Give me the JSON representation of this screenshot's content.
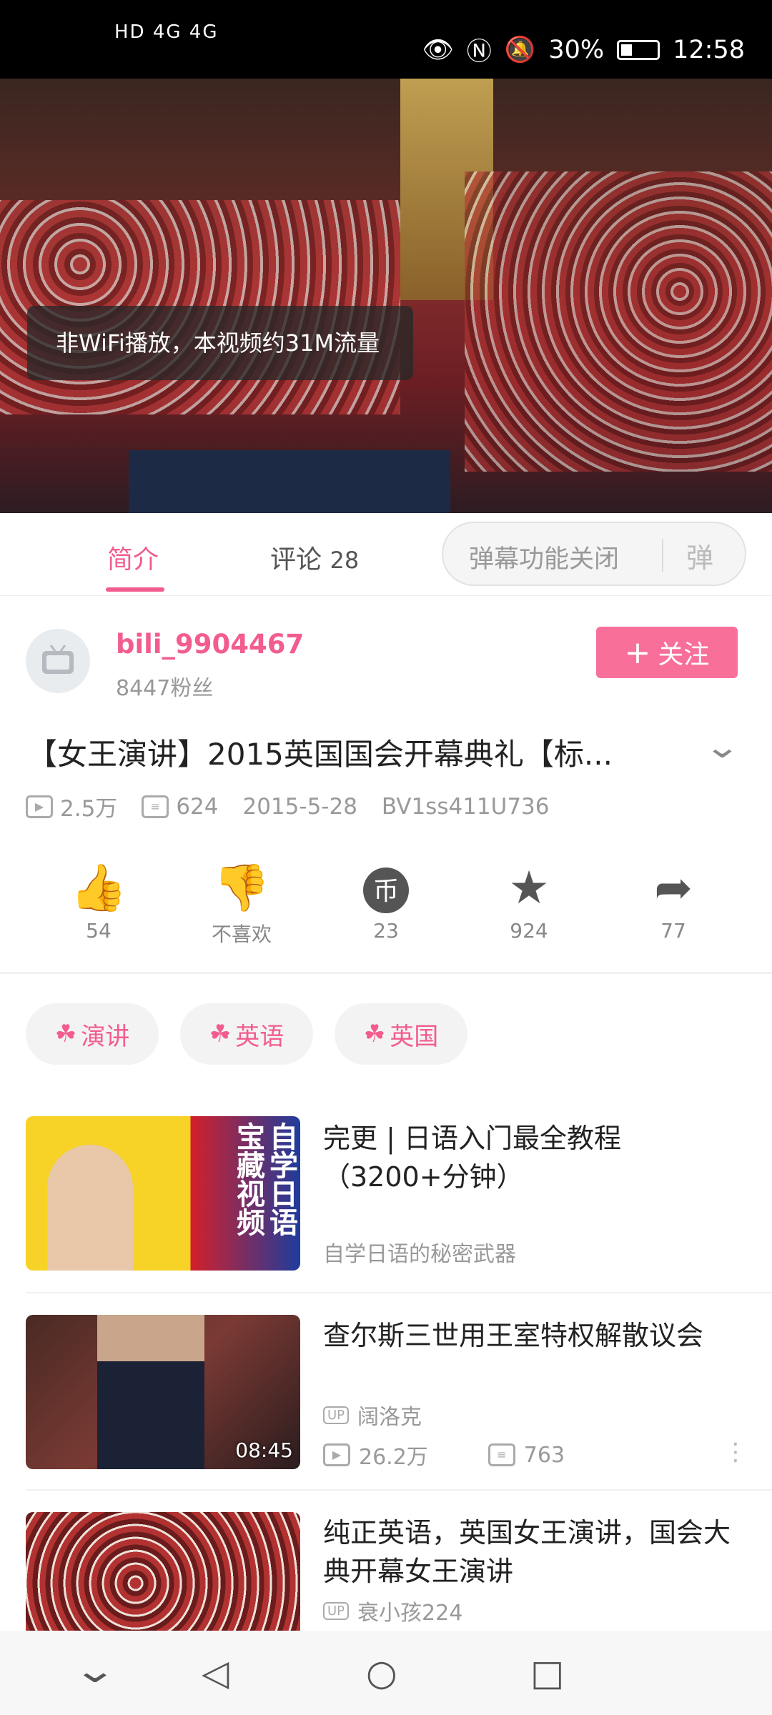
{
  "status_bar": {
    "left": "HD 4G 4G",
    "battery": "30%",
    "time": "12:58"
  },
  "video": {
    "toast": "非WiFi播放，本视频约31M流量"
  },
  "tabs": {
    "intro": "简介",
    "comments": "评论",
    "comments_count": "28",
    "danmu": "弹幕功能关闭",
    "danmu_icon": "弹"
  },
  "uploader": {
    "name": "bili_9904467",
    "fans": "8447粉丝",
    "follow": "关注"
  },
  "video_info": {
    "title": "【女王演讲】2015英国国会开幕典礼【标...",
    "views": "2.5万",
    "danmaku": "624",
    "date": "2015-5-28",
    "bvid": "BV1ss411U736"
  },
  "actions": [
    {
      "icon": "thumb-up-icon",
      "label": "54"
    },
    {
      "icon": "thumb-down-icon",
      "label": "不喜欢"
    },
    {
      "icon": "coin-icon",
      "label": "23"
    },
    {
      "icon": "star-icon",
      "label": "924"
    },
    {
      "icon": "share-icon",
      "label": "77"
    }
  ],
  "tags": [
    "演讲",
    "英语",
    "英国"
  ],
  "recommendations": [
    {
      "title": "完更 | 日语入门最全教程（3200+分钟）",
      "subtitle": "自学日语的秘密武器",
      "thumb_text": "自学日语 宝藏视频"
    },
    {
      "title": "查尔斯三世用王室特权解散议会",
      "uploader": "阔洛克",
      "views": "26.2万",
      "danmaku": "763",
      "duration": "08:45"
    },
    {
      "title": "纯正英语，英国女王演讲，国会大典开幕女王演讲",
      "uploader": "衰小孩224"
    }
  ],
  "colors": {
    "accent": "#f25d8e",
    "follow_bg": "#f86f9a"
  }
}
